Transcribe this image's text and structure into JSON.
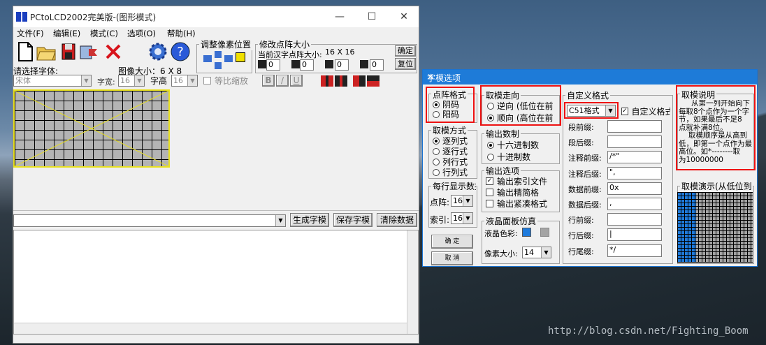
{
  "main_window": {
    "title": "PCtoLCD2002完美版-(图形模式)",
    "window_buttons": {
      "minimize": "—",
      "maximize": "☐",
      "close": "✕"
    },
    "menu": [
      "文件(F)",
      "编辑(E)",
      "模式(C)",
      "选项(O)",
      "帮助(H)"
    ],
    "adjust_group": "调整像素位置",
    "resize_group": "修改点阵大小",
    "current_size_label": "当前汉字点阵大小:",
    "current_size_value": "16 X 16",
    "confirm_button": "确定",
    "reset_button": "复位",
    "size_values": [
      "0",
      "0",
      "0",
      "0"
    ],
    "font_label": "请选择字体:",
    "image_size_label": "图像大小：6 X 8",
    "font_value": "宋体",
    "char_width_label": "字宽:",
    "char_width_value": "16",
    "char_height_label": "字高",
    "char_height_value": "16",
    "proportional_label": "等比缩放",
    "style_buttons": [
      "B",
      "/",
      "U"
    ],
    "generate_button": "生成字模",
    "save_button": "保存字模",
    "clear_button": "清除数据"
  },
  "dialog": {
    "title": "字模选项",
    "close": "✕",
    "dot_format": {
      "label": "点阵格式",
      "options": [
        "阴码",
        "阳码"
      ],
      "selected": 0
    },
    "scan_mode": {
      "label": "取模方式",
      "options": [
        "逐列式",
        "逐行式",
        "列行式",
        "行列式"
      ],
      "selected": 0
    },
    "per_line": {
      "label": "每行显示数据",
      "dot_label": "点阵:",
      "dot_value": "16",
      "index_label": "索引:",
      "index_value": "16"
    },
    "ok_button": "确 定",
    "cancel_button": "取 消",
    "direction": {
      "label": "取模走向",
      "options": [
        "逆向 (低位在前",
        "顺向 (高位在前"
      ],
      "selected": 1
    },
    "output_base": {
      "label": "输出数制",
      "options": [
        "十六进制数",
        "十进制数"
      ],
      "selected": 0
    },
    "output_options": {
      "label": "输出选项",
      "items": [
        {
          "text": "输出索引文件",
          "checked": true
        },
        {
          "text": "输出精简格",
          "checked": false
        },
        {
          "text": "输出紧凑格式",
          "checked": false
        }
      ]
    },
    "lcd_sim": {
      "label": "液晶面板仿真",
      "color_label": "液晶色彩:",
      "pixel_label": "像素大小:",
      "pixel_value": "14",
      "on_color": "#1f7bdc",
      "off_color": "#a4a4a4"
    },
    "custom_format": {
      "label": "自定义格式",
      "format_value": "C51格式",
      "custom_check": "自定义格式",
      "fields": [
        {
          "label": "段前缀:",
          "value": ""
        },
        {
          "label": "段后缀:",
          "value": ""
        },
        {
          "label": "注释前缀:",
          "value": "/*\""
        },
        {
          "label": "注释后缀:",
          "value": "\","
        },
        {
          "label": "数据前缀:",
          "value": "0x"
        },
        {
          "label": "数据后缀:",
          "value": ","
        },
        {
          "label": "行前缀:",
          "value": ""
        },
        {
          "label": "行后缀:",
          "value": "|"
        },
        {
          "label": "行尾缀:",
          "value": "*/"
        }
      ]
    },
    "description": {
      "label": "取模说明",
      "lines": [
        "从第一列开始向下",
        "每取8个点作为一个字",
        "节，如果最后不足8",
        "点就补满8位。",
        "取模顺序是从高到",
        "低，即第一个点作为最",
        "高位。如*--------取",
        "为10000000"
      ]
    },
    "demo_label": "取模演示(从低位到"
  },
  "watermark": "http://blog.csdn.net/Fighting_Boom"
}
